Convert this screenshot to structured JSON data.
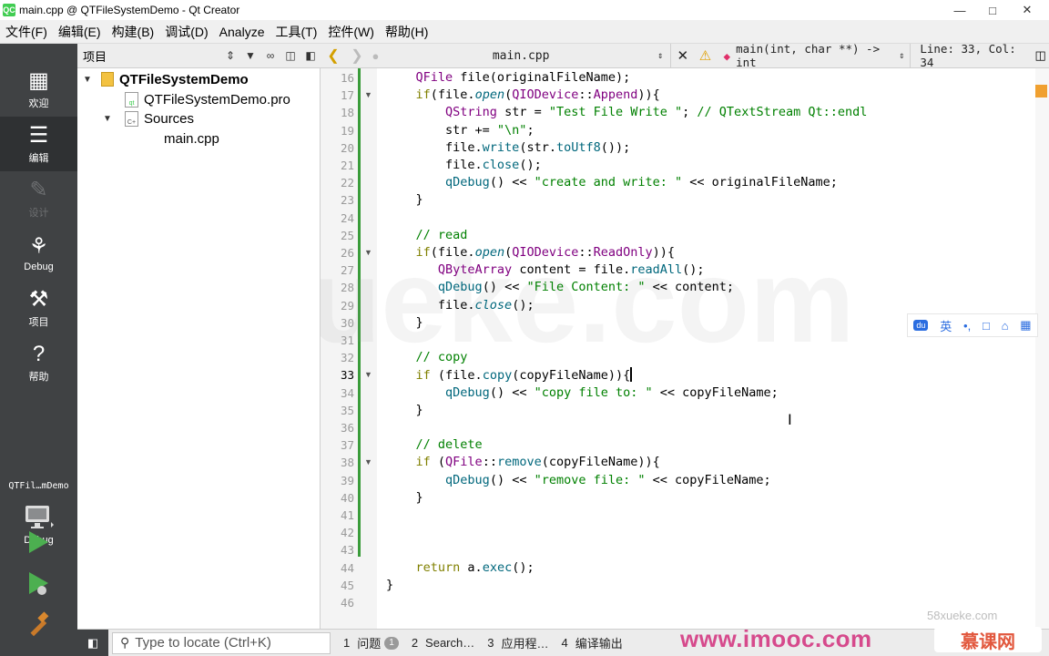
{
  "window": {
    "title": "main.cpp @ QTFileSystemDemo - Qt Creator",
    "app_icon": "QC",
    "controls": [
      "—",
      "□",
      "✕"
    ]
  },
  "menu": [
    "文件(F)",
    "编辑(E)",
    "构建(B)",
    "调试(D)",
    "Analyze",
    "工具(T)",
    "控件(W)",
    "帮助(H)"
  ],
  "modes": [
    {
      "label": "欢迎",
      "icon": "grid-icon",
      "glyph": "▦",
      "active": false,
      "disabled": false
    },
    {
      "label": "编辑",
      "icon": "document-icon",
      "glyph": "☰",
      "active": true,
      "disabled": false
    },
    {
      "label": "设计",
      "icon": "pencil-icon",
      "glyph": "✎",
      "active": false,
      "disabled": true
    },
    {
      "label": "Debug",
      "icon": "bug-icon",
      "glyph": "⚘",
      "active": false,
      "disabled": false
    },
    {
      "label": "项目",
      "icon": "wrench-icon",
      "glyph": "⚒",
      "active": false,
      "disabled": false
    },
    {
      "label": "帮助",
      "icon": "help-icon",
      "glyph": "?",
      "active": false,
      "disabled": false
    }
  ],
  "kit": {
    "project": "QTFil…mDemo",
    "config": "Debug"
  },
  "project_panel": {
    "title": "项目",
    "tree": [
      {
        "label": "QTFileSystemDemo",
        "level": 0,
        "expanded": true,
        "bold": true,
        "kind": "project"
      },
      {
        "label": "QTFileSystemDemo.pro",
        "level": 1,
        "kind": "pro"
      },
      {
        "label": "Sources",
        "level": 1,
        "expanded": true,
        "kind": "folder"
      },
      {
        "label": "main.cpp",
        "level": 2,
        "kind": "cpp"
      }
    ]
  },
  "editor_toolbar": {
    "file": "main.cpp",
    "symbol": "main(int, char **) -> int",
    "line_col": "Line: 33, Col: 34"
  },
  "editor": {
    "current_line": 33,
    "lines": [
      {
        "n": 16,
        "fold": false,
        "tokens": [
          [
            "",
            "    "
          ],
          [
            "ty",
            "QFile"
          ],
          [
            "",
            " file(originalFileName);"
          ]
        ]
      },
      {
        "n": 17,
        "fold": true,
        "tokens": [
          [
            "",
            "    "
          ],
          [
            "kw",
            "if"
          ],
          [
            "",
            "(file."
          ],
          [
            "it",
            "open"
          ],
          [
            "",
            "("
          ],
          [
            "ty",
            "QIODevice"
          ],
          [
            "",
            "::"
          ],
          [
            "ty",
            "Append"
          ],
          [
            "",
            ")){"
          ]
        ]
      },
      {
        "n": 18,
        "fold": false,
        "tokens": [
          [
            "",
            "        "
          ],
          [
            "ty",
            "QString"
          ],
          [
            "",
            " str = "
          ],
          [
            "st",
            "\"Test File Write \""
          ],
          [
            "",
            "; "
          ],
          [
            "cm",
            "// QTextStream Qt::endl"
          ]
        ]
      },
      {
        "n": 19,
        "fold": false,
        "tokens": [
          [
            "",
            "        str += "
          ],
          [
            "st",
            "\"\\n\""
          ],
          [
            "",
            ";"
          ]
        ]
      },
      {
        "n": 20,
        "fold": false,
        "tokens": [
          [
            "",
            "        file."
          ],
          [
            "fn",
            "write"
          ],
          [
            "",
            "(str."
          ],
          [
            "fn",
            "toUtf8"
          ],
          [
            "",
            "());"
          ]
        ]
      },
      {
        "n": 21,
        "fold": false,
        "tokens": [
          [
            "",
            "        file."
          ],
          [
            "fn",
            "close"
          ],
          [
            "",
            "();"
          ]
        ]
      },
      {
        "n": 22,
        "fold": false,
        "tokens": [
          [
            "",
            "        "
          ],
          [
            "fn",
            "qDebug"
          ],
          [
            "",
            "() << "
          ],
          [
            "st",
            "\"create and write: \""
          ],
          [
            "",
            " << originalFileName;"
          ]
        ]
      },
      {
        "n": 23,
        "fold": false,
        "tokens": [
          [
            "",
            "    }"
          ]
        ]
      },
      {
        "n": 24,
        "fold": false,
        "tokens": [
          [
            "",
            ""
          ]
        ]
      },
      {
        "n": 25,
        "fold": false,
        "tokens": [
          [
            "",
            "    "
          ],
          [
            "cm",
            "// read"
          ]
        ]
      },
      {
        "n": 26,
        "fold": true,
        "tokens": [
          [
            "",
            "    "
          ],
          [
            "kw",
            "if"
          ],
          [
            "",
            "(file."
          ],
          [
            "it",
            "open"
          ],
          [
            "",
            "("
          ],
          [
            "ty",
            "QIODevice"
          ],
          [
            "",
            "::"
          ],
          [
            "ty",
            "ReadOnly"
          ],
          [
            "",
            ")){"
          ]
        ]
      },
      {
        "n": 27,
        "fold": false,
        "tokens": [
          [
            "",
            "       "
          ],
          [
            "ty",
            "QByteArray"
          ],
          [
            "",
            " content = file."
          ],
          [
            "fn",
            "readAll"
          ],
          [
            "",
            "();"
          ]
        ]
      },
      {
        "n": 28,
        "fold": false,
        "tokens": [
          [
            "",
            "       "
          ],
          [
            "fn",
            "qDebug"
          ],
          [
            "",
            "() << "
          ],
          [
            "st",
            "\"File Content: \""
          ],
          [
            "",
            " << content;"
          ]
        ]
      },
      {
        "n": 29,
        "fold": false,
        "tokens": [
          [
            "",
            "       file."
          ],
          [
            "it",
            "close"
          ],
          [
            "",
            "();"
          ]
        ]
      },
      {
        "n": 30,
        "fold": false,
        "tokens": [
          [
            "",
            "    }"
          ]
        ]
      },
      {
        "n": 31,
        "fold": false,
        "tokens": [
          [
            "",
            ""
          ]
        ]
      },
      {
        "n": 32,
        "fold": false,
        "tokens": [
          [
            "",
            "    "
          ],
          [
            "cm",
            "// copy"
          ]
        ]
      },
      {
        "n": 33,
        "fold": true,
        "cursor": true,
        "tokens": [
          [
            "",
            "    "
          ],
          [
            "kw",
            "if"
          ],
          [
            "",
            " (file."
          ],
          [
            "fn",
            "copy"
          ],
          [
            "",
            "(copyFileName)){"
          ]
        ]
      },
      {
        "n": 34,
        "fold": false,
        "tokens": [
          [
            "",
            "        "
          ],
          [
            "fn",
            "qDebug"
          ],
          [
            "",
            "() << "
          ],
          [
            "st",
            "\"copy file to: \""
          ],
          [
            "",
            " << copyFileName;"
          ]
        ]
      },
      {
        "n": 35,
        "fold": false,
        "tokens": [
          [
            "",
            "    }"
          ]
        ]
      },
      {
        "n": 36,
        "fold": false,
        "tokens": [
          [
            "",
            ""
          ]
        ]
      },
      {
        "n": 37,
        "fold": false,
        "tokens": [
          [
            "",
            "    "
          ],
          [
            "cm",
            "// delete"
          ]
        ]
      },
      {
        "n": 38,
        "fold": true,
        "tokens": [
          [
            "",
            "    "
          ],
          [
            "kw",
            "if"
          ],
          [
            "",
            " ("
          ],
          [
            "ty",
            "QFile"
          ],
          [
            "",
            "::"
          ],
          [
            "fn",
            "remove"
          ],
          [
            "",
            "(copyFileName)){"
          ]
        ]
      },
      {
        "n": 39,
        "fold": false,
        "tokens": [
          [
            "",
            "        "
          ],
          [
            "fn",
            "qDebug"
          ],
          [
            "",
            "() << "
          ],
          [
            "st",
            "\"remove file: \""
          ],
          [
            "",
            " << copyFileName;"
          ]
        ]
      },
      {
        "n": 40,
        "fold": false,
        "tokens": [
          [
            "",
            "    }"
          ]
        ]
      },
      {
        "n": 41,
        "fold": false,
        "tokens": [
          [
            "",
            ""
          ]
        ]
      },
      {
        "n": 42,
        "fold": false,
        "tokens": [
          [
            "",
            ""
          ]
        ]
      },
      {
        "n": 43,
        "fold": false,
        "tokens": [
          [
            "",
            ""
          ]
        ]
      },
      {
        "n": 44,
        "fold": false,
        "tokens": [
          [
            "",
            "    "
          ],
          [
            "kw",
            "return"
          ],
          [
            "",
            " a."
          ],
          [
            "fn",
            "exec"
          ],
          [
            "",
            "();"
          ]
        ]
      },
      {
        "n": 45,
        "fold": false,
        "tokens": [
          [
            "",
            "}"
          ]
        ]
      },
      {
        "n": 46,
        "fold": false,
        "tokens": [
          [
            "",
            ""
          ]
        ]
      }
    ]
  },
  "ime_bar": [
    "du",
    "英",
    "•,",
    "□",
    "⌂",
    "▦"
  ],
  "statusbar": {
    "locator_placeholder": "Type to locate (Ctrl+K)",
    "panes": [
      {
        "num": "1",
        "label": "问题",
        "badge": "1"
      },
      {
        "num": "2",
        "label": "Search…"
      },
      {
        "num": "3",
        "label": "应用程…"
      },
      {
        "num": "4",
        "label": "编译输出"
      }
    ]
  },
  "watermarks": {
    "editor": "58xueke.com",
    "corner": "58xueke.com",
    "site": "www.imooc.com",
    "brand": "慕课网"
  },
  "colors": {
    "mode_bar": "#404244",
    "accent_green": "#41cd52",
    "keyword": "#808000",
    "type": "#800080",
    "function": "#00677c",
    "string": "#008000"
  }
}
